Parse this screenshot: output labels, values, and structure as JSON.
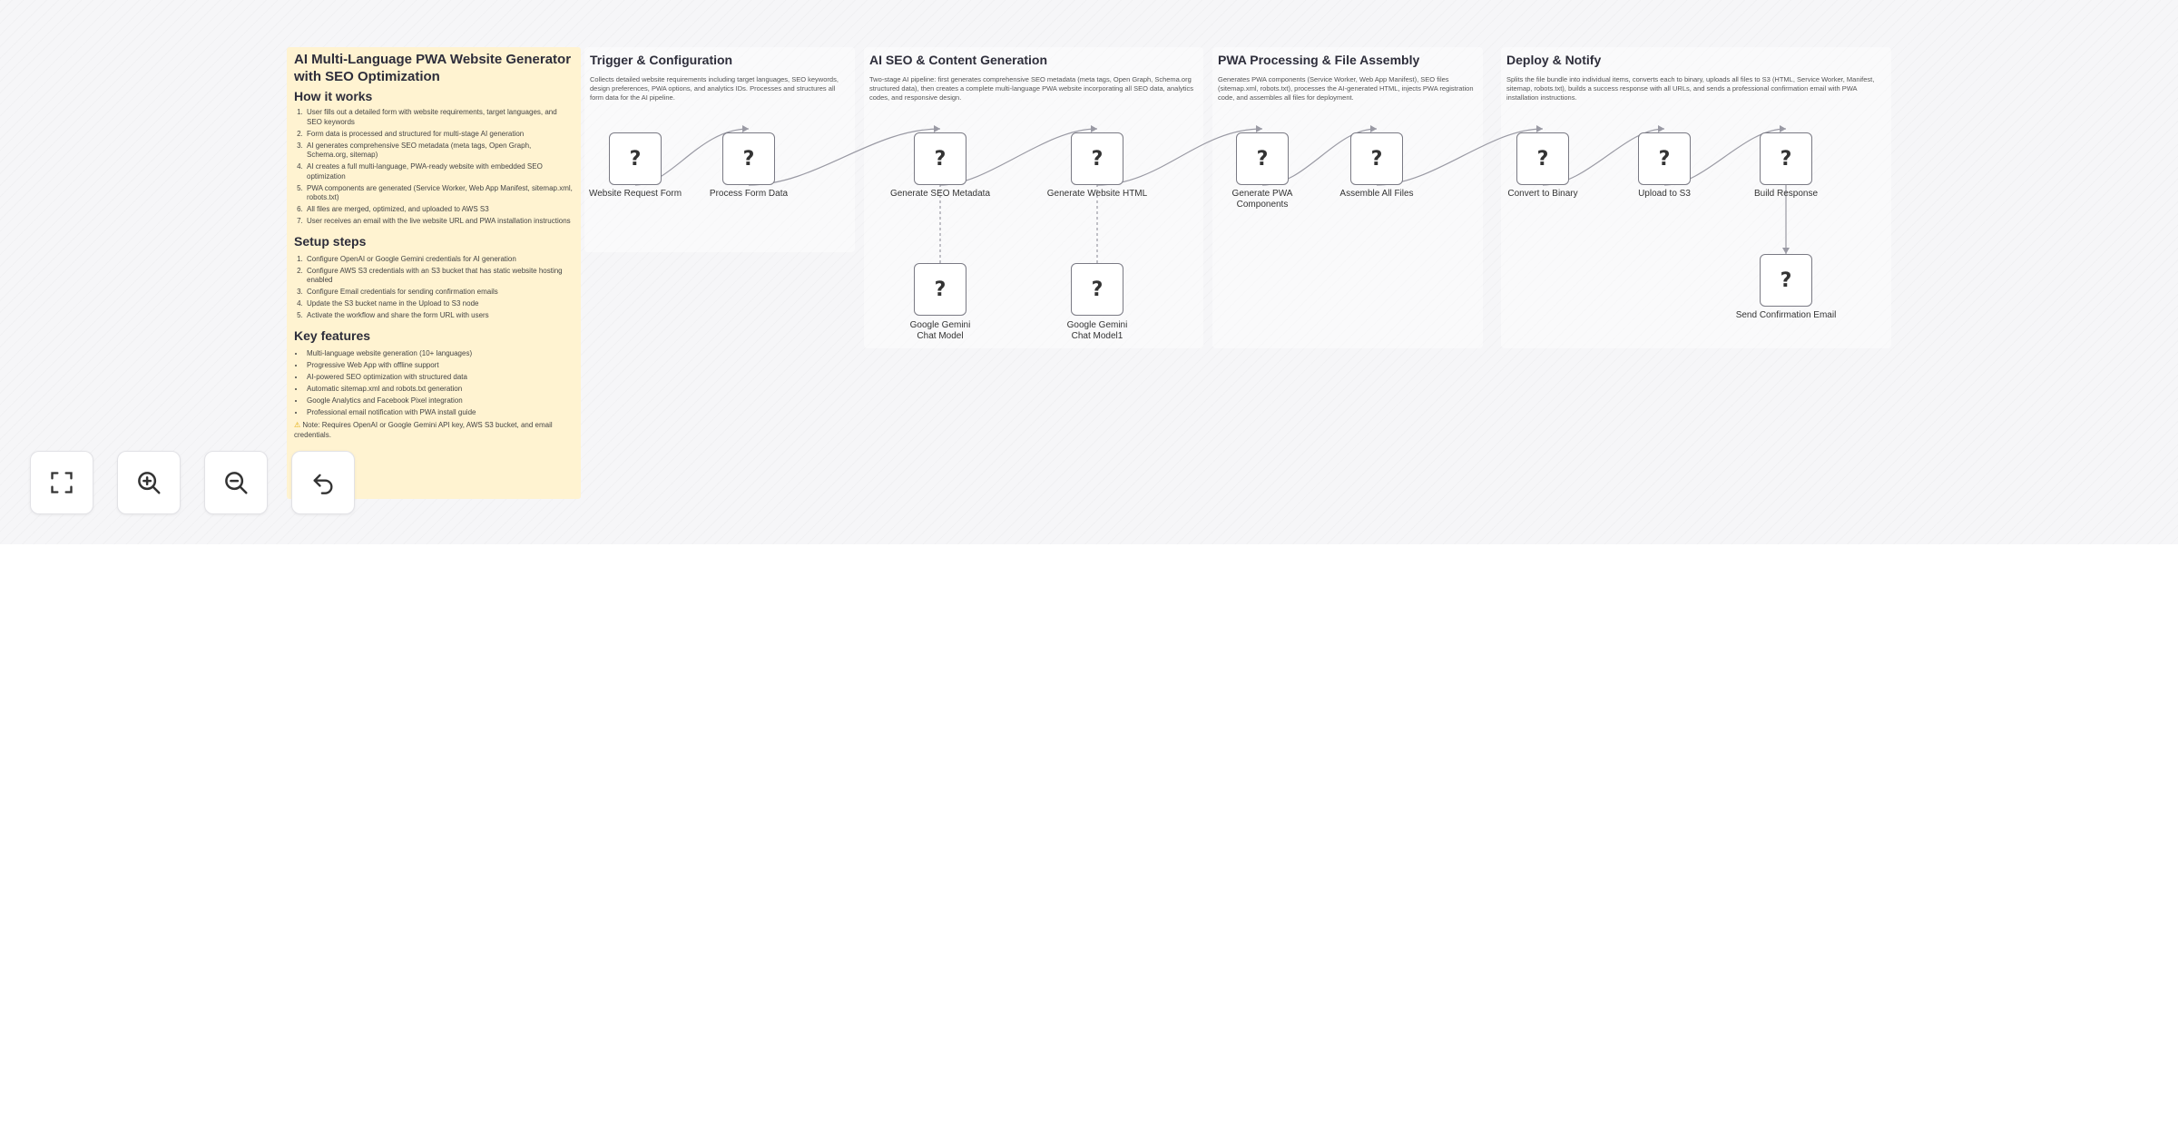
{
  "main_note": {
    "title": "AI Multi-Language PWA Website Generator with SEO Optimization",
    "how_heading": "How it works",
    "how_items": [
      "User fills out a detailed form with website requirements, target languages, and SEO keywords",
      "Form data is processed and structured for multi-stage AI generation",
      "AI generates comprehensive SEO metadata (meta tags, Open Graph, Schema.org, sitemap)",
      "AI creates a full multi-language, PWA-ready website with embedded SEO optimization",
      "PWA components are generated (Service Worker, Web App Manifest, sitemap.xml, robots.txt)",
      "All files are merged, optimized, and uploaded to AWS S3",
      "User receives an email with the live website URL and PWA installation instructions"
    ],
    "setup_heading": "Setup steps",
    "setup_items": [
      "Configure OpenAI or Google Gemini credentials for AI generation",
      "Configure AWS S3 credentials with an S3 bucket that has static website hosting enabled",
      "Configure Email credentials for sending confirmation emails",
      "Update the S3 bucket name in the Upload to S3 node",
      "Activate the workflow and share the form URL with users"
    ],
    "features_heading": "Key features",
    "features_items": [
      "Multi-language website generation (10+ languages)",
      "Progressive Web App with offline support",
      "AI-powered SEO optimization with structured data",
      "Automatic sitemap.xml and robots.txt generation",
      "Google Analytics and Facebook Pixel integration",
      "Professional email notification with PWA install guide"
    ],
    "note": "Note: Requires OpenAI or Google Gemini API key, AWS S3 bucket, and email credentials."
  },
  "sections": [
    {
      "title": "Trigger & Configuration",
      "desc": "Collects detailed website requirements including target languages, SEO keywords, design preferences, PWA options, and analytics IDs. Processes and structures all form data for the AI pipeline."
    },
    {
      "title": "AI SEO & Content Generation",
      "desc": "Two-stage AI pipeline: first generates comprehensive SEO metadata (meta tags, Open Graph, Schema.org structured data), then creates a complete multi-language PWA website incorporating all SEO data, analytics codes, and responsive design."
    },
    {
      "title": "PWA Processing & File Assembly",
      "desc": "Generates PWA components (Service Worker, Web App Manifest), SEO files (sitemap.xml, robots.txt), processes the AI-generated HTML, injects PWA registration code, and assembles all files for deployment."
    },
    {
      "title": "Deploy & Notify",
      "desc": "Splits the file bundle into individual items, converts each to binary, uploads all files to S3 (HTML, Service Worker, Manifest, sitemap, robots.txt), builds a success response with all URLs, and sends a professional confirmation email with PWA installation instructions."
    }
  ],
  "nodes": [
    {
      "id": "form",
      "label": "Website Request Form"
    },
    {
      "id": "process",
      "label": "Process Form Data"
    },
    {
      "id": "seo",
      "label": "Generate SEO Metadata"
    },
    {
      "id": "html",
      "label": "Generate Website HTML"
    },
    {
      "id": "gem1",
      "label": "Google Gemini Chat Model"
    },
    {
      "id": "gem2",
      "label": "Google Gemini Chat Model1"
    },
    {
      "id": "pwa",
      "label": "Generate PWA Components"
    },
    {
      "id": "assemble",
      "label": "Assemble All Files"
    },
    {
      "id": "binary",
      "label": "Convert to Binary"
    },
    {
      "id": "s3",
      "label": "Upload to S3"
    },
    {
      "id": "build",
      "label": "Build Response"
    },
    {
      "id": "email",
      "label": "Send Confirmation Email"
    }
  ],
  "node_glyph": "?",
  "controls": [
    {
      "name": "fit-view-button",
      "icon": "expand-icon"
    },
    {
      "name": "zoom-in-button",
      "icon": "zoom-in-icon"
    },
    {
      "name": "zoom-out-button",
      "icon": "zoom-out-icon"
    },
    {
      "name": "undo-button",
      "icon": "undo-icon"
    }
  ],
  "colors": {
    "sticky_main": "#fff3d1",
    "link": "#e06a5a",
    "node_border": "#7a7a84",
    "edge": "#9a9aa4"
  }
}
